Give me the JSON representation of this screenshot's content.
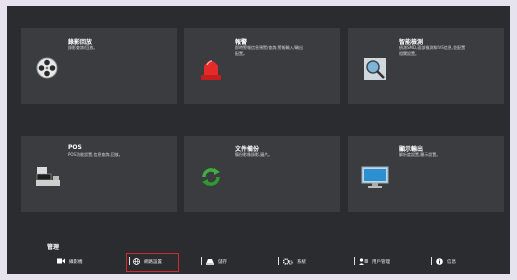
{
  "cards": [
    {
      "title": "錄影回放",
      "desc": "錄影查詢/回放。",
      "icon": "film-reel-icon"
    },
    {
      "title": "報警",
      "desc": [
        "即時警報信息預覽/查詢,警報輸入/輸出",
        "配置。"
      ],
      "icon": "alarm-siren-icon"
    },
    {
      "title": "智能檢測",
      "desc": [
        "偵測SMD,面部檢測和IVS信息,並配置",
        "相關設置。"
      ],
      "icon": "smart-detect-icon"
    },
    {
      "title": "POS",
      "desc": "POS功能設置,信息查詢,回放。",
      "icon": "pos-terminal-icon"
    },
    {
      "title": "文件備份",
      "desc": "備份影像錄影,圖片。",
      "icon": "backup-arrows-icon"
    },
    {
      "title": "顯示輸出",
      "desc": "解析度設置,顯示設置。",
      "icon": "monitor-icon"
    }
  ],
  "management": {
    "title": "管理",
    "items": [
      {
        "label": "攝影機",
        "icon": "camera-icon"
      },
      {
        "label": "網路設置",
        "icon": "network-globe-icon",
        "selected": true
      },
      {
        "label": "儲存",
        "icon": "storage-icon"
      },
      {
        "label": "系統",
        "icon": "gear-icon"
      },
      {
        "label": "用戶管理",
        "icon": "user-icon"
      },
      {
        "label": "信息",
        "icon": "info-icon"
      }
    ]
  },
  "colors": {
    "background": "#2a2c2f",
    "card": "#3a3c3f",
    "highlight": "#d22a2a"
  }
}
